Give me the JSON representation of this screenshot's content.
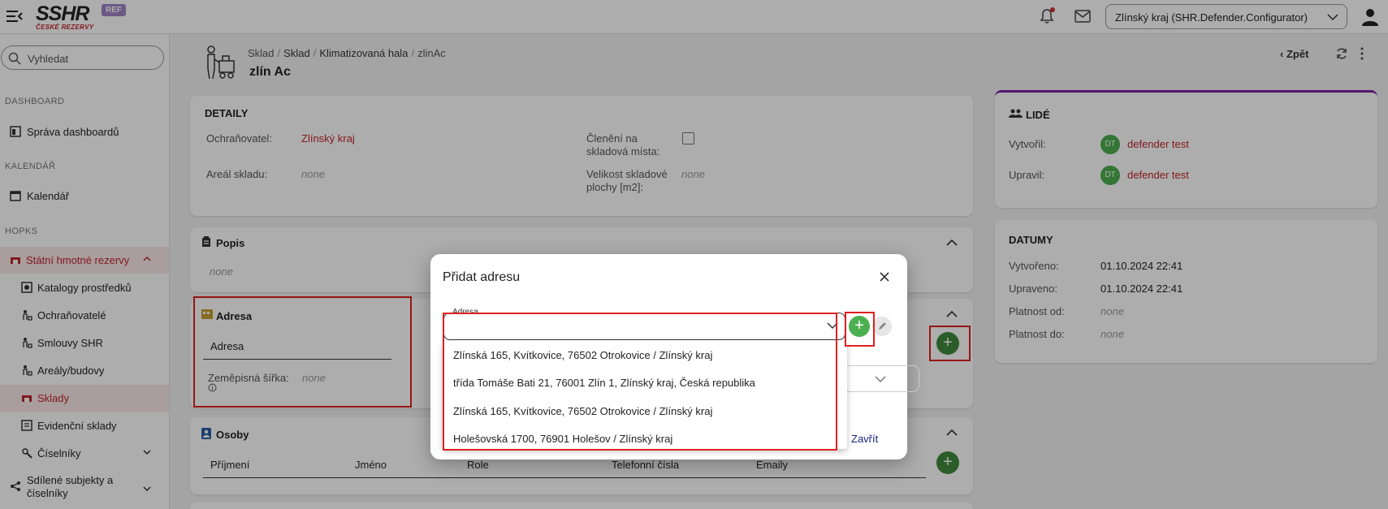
{
  "topbar": {
    "logo_text": "SSHR",
    "logo_sub": "ČESKÉ REZERVY",
    "ref_badge": "REF",
    "org_select": "Zlínský kraj (SHR.Defender.Configurator)"
  },
  "sidebar": {
    "search_placeholder": "Vyhledat",
    "sections": {
      "dashboard": "DASHBOARD",
      "calendar": "KALENDÁŘ",
      "hopks": "HOPKS"
    },
    "items": {
      "dashboards": "Správa dashboardů",
      "calendar": "Kalendář",
      "shr": "Státní hmotné rezervy",
      "catalogs": "Katalogy prostředků",
      "protectors": "Ochraňovatelé",
      "contracts": "Smlouvy SHR",
      "areas": "Areály/budovy",
      "warehouses": "Sklady",
      "registry": "Evidenční sklady",
      "codebooks": "Číselníky",
      "shared": "Sdílené subjekty a číselníky"
    }
  },
  "header": {
    "breadcrumb": [
      "Sklad",
      "Sklad",
      "Klimatizovaná hala",
      "zlinAc"
    ],
    "title": "zlín Ac",
    "back": "Zpět"
  },
  "details": {
    "title": "DETAILY",
    "protector_label": "Ochraňovatel:",
    "protector_value": "Zlínský kraj",
    "area_label": "Areál skladu:",
    "area_value": "none",
    "division_label": "Členění na skladová místa:",
    "size_label": "Velikost skladové plochy [m2]:",
    "size_value": "none"
  },
  "popis": {
    "title": "Popis",
    "value": "none"
  },
  "adresa": {
    "title": "Adresa",
    "col": "Adresa",
    "lat_label": "Zeměpisná šířka:",
    "lat_value": "none"
  },
  "osoby": {
    "title": "Osoby",
    "columns": [
      "Příjmení",
      "Jméno",
      "Role",
      "Telefonní čísla",
      "Emaily"
    ]
  },
  "lide": {
    "title": "LIDÉ",
    "created_label": "Vytvořil:",
    "created_initials": "DT",
    "created_user": "defender test",
    "updated_label": "Upravil:",
    "updated_initials": "DT",
    "updated_user": "defender test"
  },
  "datumy": {
    "title": "DATUMY",
    "created_label": "Vytvořeno:",
    "created_value": "01.10.2024 22:41",
    "updated_label": "Upraveno:",
    "updated_value": "01.10.2024 22:41",
    "valid_from_label": "Platnost od:",
    "valid_from_value": "none",
    "valid_to_label": "Platnost do:",
    "valid_to_value": "none"
  },
  "modal": {
    "title": "Přidat adresu",
    "field_label": "Adresa",
    "close": "Zavřít",
    "options": [
      "Zlínská 165, Kvítkovice, 76502 Otrokovice / Zlínský kraj",
      "třída Tomáše Bati 21, 76001 Zlín 1, Zlínský kraj, Česká republika",
      "Zlínská 165, Kvítkovice, 76502 Otrokovice / Zlínský kraj",
      "Holešovská 1700, 76901 Holešov / Zlínský kraj"
    ]
  },
  "colors": {
    "accent_red": "#c0262d",
    "green": "#3e8a3a",
    "purple": "#7b1fa2"
  }
}
